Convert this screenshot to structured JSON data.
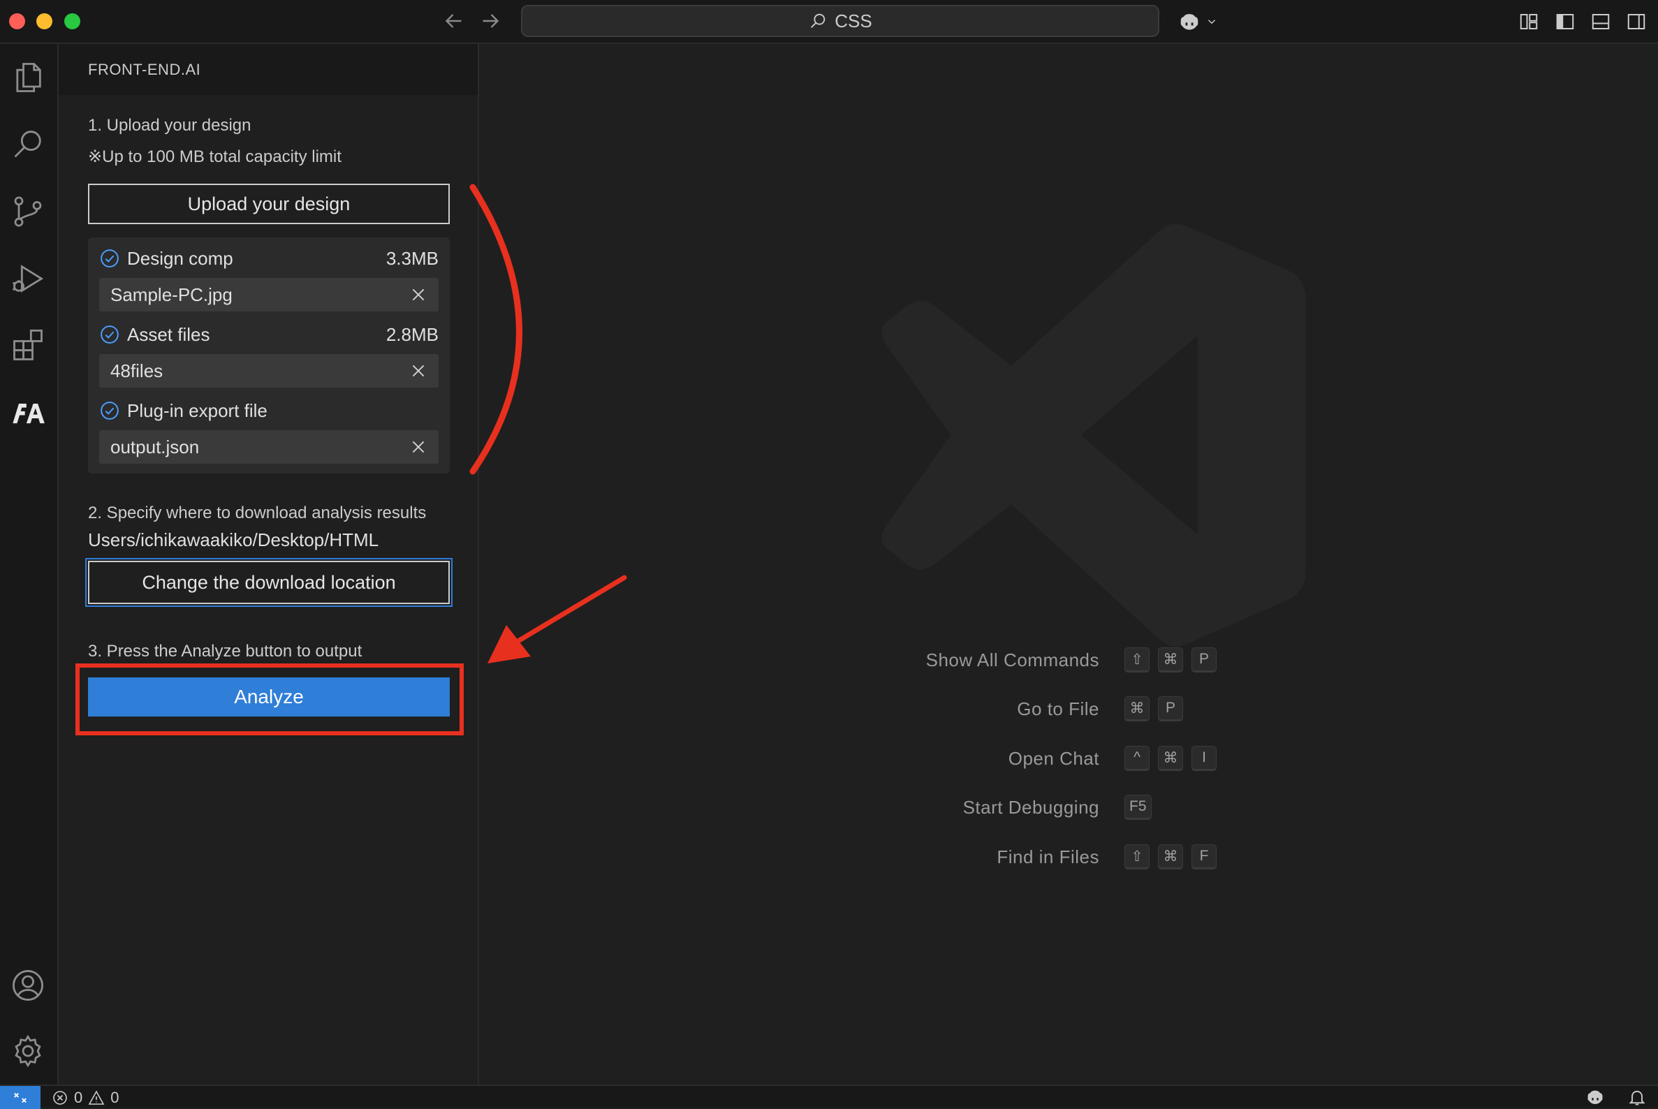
{
  "titlebar": {
    "search_text": "CSS",
    "icons": [
      "nav-back-icon",
      "nav-forward-icon",
      "search-icon",
      "copilot-icon",
      "chevron-down-icon",
      "customize-layout-icon",
      "toggle-primary-sidebar-icon",
      "toggle-panel-icon",
      "toggle-secondary-sidebar-icon"
    ]
  },
  "activitybar": {
    "items": [
      "explorer",
      "search",
      "source-control",
      "run-and-debug",
      "extensions",
      "front-end-ai",
      "accounts",
      "manage"
    ]
  },
  "sidebar": {
    "title": "FRONT-END.AI",
    "step1": {
      "heading": "1. Upload your design",
      "note": "※Up to 100 MB total capacity limit",
      "upload_label": "Upload your design"
    },
    "files": [
      {
        "category": "Design comp",
        "size": "3.3MB",
        "file": "Sample-PC.jpg"
      },
      {
        "category": "Asset files",
        "size": "2.8MB",
        "file": "48files"
      },
      {
        "category": "Plug-in export file",
        "size": "",
        "file": "output.json"
      }
    ],
    "step2": {
      "heading": "2. Specify where to download analysis results",
      "path": "Users/ichikawaakiko/Desktop/HTML",
      "button_label": "Change the download location"
    },
    "step3": {
      "heading": "3. Press the Analyze button to output",
      "button_label": "Analyze"
    }
  },
  "editor": {
    "shortcuts": [
      {
        "label": "Show All Commands",
        "keys": [
          "⇧",
          "⌘",
          "P"
        ]
      },
      {
        "label": "Go to File",
        "keys": [
          "⌘",
          "P"
        ]
      },
      {
        "label": "Open Chat",
        "keys": [
          "^",
          "⌘",
          "I"
        ]
      },
      {
        "label": "Start Debugging",
        "keys": [
          "F5"
        ]
      },
      {
        "label": "Find in Files",
        "keys": [
          "⇧",
          "⌘",
          "F"
        ]
      }
    ]
  },
  "statusbar": {
    "errors": "0",
    "warnings": "0"
  },
  "colors": {
    "accent": "#2f7ed8",
    "annotation": "#e8301f",
    "check": "#4a9eff"
  }
}
